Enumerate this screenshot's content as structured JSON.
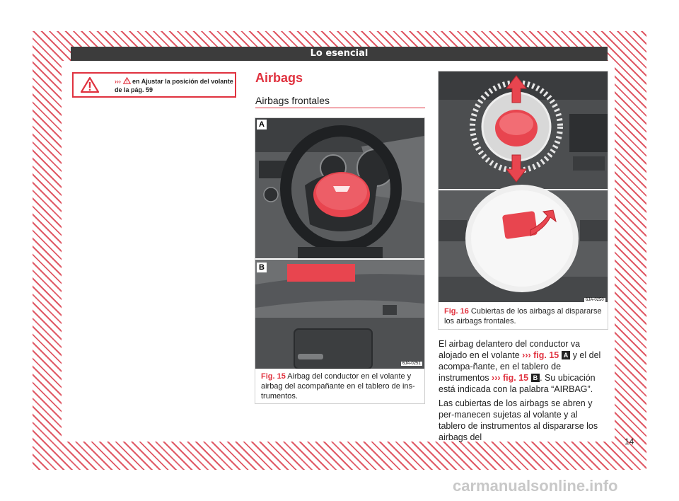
{
  "header": {
    "title": "Lo esencial"
  },
  "warning": {
    "arrows": "›››",
    "text": "en Ajustar la posición del volante de la pág. 59"
  },
  "section": {
    "title": "Airbags",
    "subtitle": "Airbags frontales"
  },
  "fig15": {
    "label_a": "A",
    "label_b": "B",
    "code": "6JA-0251",
    "fig_num": "Fig. 15",
    "caption": "Airbag del conductor en el volante y airbag del acompañante en el tablero de ins-trumentos."
  },
  "fig16": {
    "code": "6JA-0250",
    "fig_num": "Fig. 16",
    "caption": "Cubiertas de los airbags al dispararse los airbags frontales."
  },
  "body": {
    "p1_a": "El airbag delantero del conductor va alojado en el volante ",
    "p1_ref1": "››› fig. 15",
    "p1_letter_a": "A",
    "p1_b": " y el del acompa-ñante, en el tablero de instrumentos ",
    "p1_ref2": "››› fig. 15",
    "p1_letter_b": "B",
    "p1_c": ". Su ubicación está indicada con la palabra “AIRBAG”.",
    "p2": "Las cubiertas de los airbags se abren y per-manecen sujetas al volante y al tablero de instrumentos al dispararse los airbags del"
  },
  "page_number": "14",
  "watermark": "carmanualsonline.info",
  "colors": {
    "accent": "#e0323f",
    "header_bg": "#3c3c3c"
  }
}
